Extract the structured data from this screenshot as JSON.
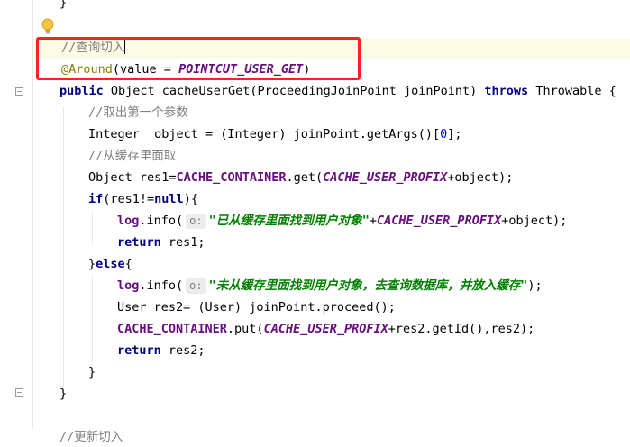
{
  "editor": {
    "lines": [
      [
        {
          "t": "}",
          "c": ""
        }
      ],
      [],
      [
        {
          "t": "//查询切入",
          "c": "cm"
        }
      ],
      [
        {
          "t": "@Around",
          "c": "an"
        },
        {
          "t": "(value = ",
          "c": ""
        },
        {
          "t": "POINTCUT_USER_GET",
          "c": "ct"
        },
        {
          "t": ")",
          "c": ""
        }
      ],
      [
        {
          "t": "public ",
          "c": "kw"
        },
        {
          "t": "Object cacheUserGet(ProceedingJoinPoint joinPoint) ",
          "c": ""
        },
        {
          "t": "throws ",
          "c": "kw"
        },
        {
          "t": "Throwable {",
          "c": ""
        }
      ],
      [
        {
          "t": "//取出第一个参数",
          "c": "cm"
        }
      ],
      [
        {
          "t": "Integer  object = (Integer) joinPoint.getArgs()[",
          "c": ""
        },
        {
          "t": "0",
          "c": "num"
        },
        {
          "t": "];",
          "c": ""
        }
      ],
      [
        {
          "t": "//从缓存里面取",
          "c": "cm"
        }
      ],
      [
        {
          "t": "Object res1=",
          "c": ""
        },
        {
          "t": "CACHE_CONTAINER",
          "c": "fld"
        },
        {
          "t": ".get(",
          "c": ""
        },
        {
          "t": "CACHE_USER_PROFIX",
          "c": "ct"
        },
        {
          "t": "+object);",
          "c": ""
        }
      ],
      [
        {
          "t": "if",
          "c": "kw"
        },
        {
          "t": "(res1!=",
          "c": ""
        },
        {
          "t": "null",
          "c": "kw"
        },
        {
          "t": "){",
          "c": ""
        }
      ],
      [
        {
          "t": "log",
          "c": "fld"
        },
        {
          "t": ".info(",
          "c": ""
        },
        {
          "t": "o:",
          "c": "hint"
        },
        {
          "t": "\"已从缓存里面找到用户对象\"",
          "c": "st"
        },
        {
          "t": "+",
          "c": ""
        },
        {
          "t": "CACHE_USER_PROFIX",
          "c": "ct"
        },
        {
          "t": "+object);",
          "c": ""
        }
      ],
      [
        {
          "t": "return ",
          "c": "kw"
        },
        {
          "t": "res1;",
          "c": ""
        }
      ],
      [
        {
          "t": "}",
          "c": ""
        },
        {
          "t": "else",
          "c": "kw"
        },
        {
          "t": "{",
          "c": ""
        }
      ],
      [
        {
          "t": "log",
          "c": "fld"
        },
        {
          "t": ".info(",
          "c": ""
        },
        {
          "t": "o:",
          "c": "hint"
        },
        {
          "t": "\"未从缓存里面找到用户对象，去查询数据库，并放入缓存\"",
          "c": "st"
        },
        {
          "t": ");",
          "c": ""
        }
      ],
      [
        {
          "t": "User res2= (User) joinPoint.proceed();",
          "c": ""
        }
      ],
      [
        {
          "t": "CACHE_CONTAINER",
          "c": "fld"
        },
        {
          "t": ".put(",
          "c": ""
        },
        {
          "t": "CACHE_USER_PROFIX",
          "c": "ct"
        },
        {
          "t": "+res2.getId(),res2);",
          "c": ""
        }
      ],
      [
        {
          "t": "return ",
          "c": "kw"
        },
        {
          "t": "res2;",
          "c": ""
        }
      ],
      [
        {
          "t": "}",
          "c": ""
        }
      ],
      [
        {
          "t": "}",
          "c": ""
        }
      ],
      [],
      [
        {
          "t": "//更新切入",
          "c": "cm"
        }
      ]
    ]
  }
}
